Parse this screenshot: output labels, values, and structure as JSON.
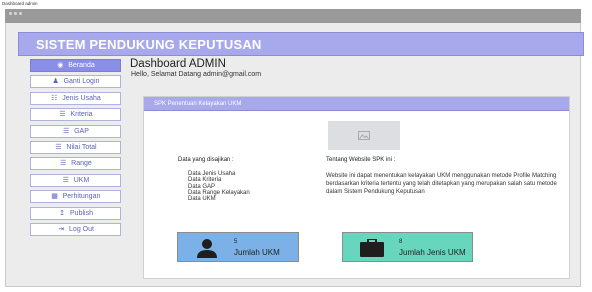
{
  "window": {
    "title": "Dashboard admin"
  },
  "app": {
    "title": "SISTEM PENDUKUNG KEPUTUSAN"
  },
  "sidebar": {
    "items": [
      {
        "label": "Beranda",
        "icon": "dashboard-icon",
        "active": true
      },
      {
        "label": "Ganti Login",
        "icon": "users-icon"
      },
      {
        "label": "Jenis Usaha",
        "icon": "sitemap-icon"
      },
      {
        "label": "Kriteria",
        "icon": "list-icon"
      },
      {
        "label": "GAP",
        "icon": "list-icon"
      },
      {
        "label": "Nilai Total",
        "icon": "list-icon"
      },
      {
        "label": "Range",
        "icon": "list-icon"
      },
      {
        "label": "UKM",
        "icon": "list-icon"
      },
      {
        "label": "Perhitungan",
        "icon": "calculator-icon"
      },
      {
        "label": "Publish",
        "icon": "upload-icon"
      },
      {
        "label": "Log Out",
        "icon": "logout-icon"
      }
    ]
  },
  "main": {
    "title": "Dashboard ADMIN",
    "greeting": "Hello, Selamat Datang admin@gmail.com"
  },
  "panel": {
    "title": "SPK Penentuan Kelayakan UKM",
    "data_heading": "Data yang disajikan :",
    "data_items": [
      "Data Jenis Usaha",
      "Data Kriteria",
      "Data GAP",
      "Data Range Kelayakan",
      "Data UKM"
    ],
    "about_heading": "Tentang Website SPK ini :",
    "about_text": "Website ini dapat menentukan kelayakan UKM menggunakan metode Profile Matching berdasarkan kriteria tertentu yang telah ditetapkan yang merupakan salah satu metode dalam Sistem Pendukung Keputusan"
  },
  "stats": {
    "ukm": {
      "count": "5",
      "label": "Jumlah UKM",
      "icon": "user-icon",
      "color": "#7bb1e6"
    },
    "jenis": {
      "count": "8",
      "label": "Jumlah Jenis UKM",
      "icon": "briefcase-icon",
      "color": "#68d6bd"
    }
  },
  "colors": {
    "accent": "#a8a8ec",
    "nav_text": "#5b63b8",
    "nav_active": "#8a8ee6"
  }
}
